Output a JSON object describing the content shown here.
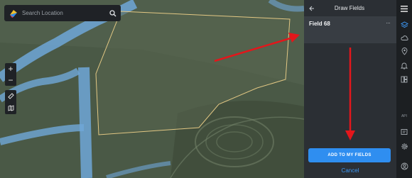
{
  "search": {
    "placeholder": "Search Location"
  },
  "map_controls": {
    "zoom_in": "+",
    "zoom_out": "−"
  },
  "panel": {
    "title": "Draw Fields",
    "field_name": "Field 68",
    "more_label": "···",
    "add_button": "ADD TO MY FIELDS",
    "cancel": "Cancel"
  },
  "rail": {
    "api_label": "API"
  },
  "colors": {
    "accent": "#2f8ef0",
    "arrow": "#e3161b",
    "polygon": "#e3c884",
    "water": "#6fa7d8"
  }
}
